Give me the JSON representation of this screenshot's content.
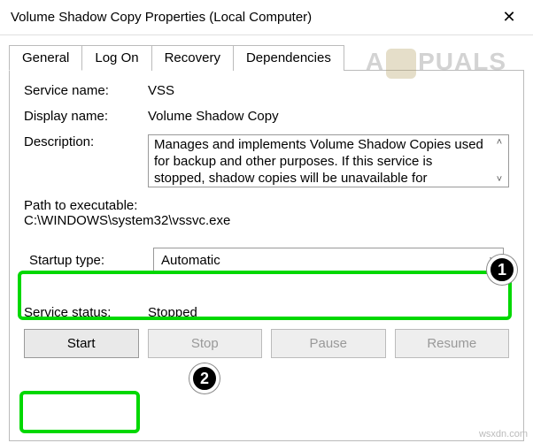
{
  "window": {
    "title": "Volume Shadow Copy Properties (Local Computer)"
  },
  "tabs": [
    {
      "label": "General",
      "active": true
    },
    {
      "label": "Log On",
      "active": false
    },
    {
      "label": "Recovery",
      "active": false
    },
    {
      "label": "Dependencies",
      "active": false
    }
  ],
  "fields": {
    "service_name_label": "Service name:",
    "service_name_value": "VSS",
    "display_name_label": "Display name:",
    "display_name_value": "Volume Shadow Copy",
    "description_label": "Description:",
    "description_value": "Manages and implements Volume Shadow Copies used for backup and other purposes. If this service is stopped, shadow copies will be unavailable for",
    "path_label": "Path to executable:",
    "path_value": "C:\\WINDOWS\\system32\\vssvc.exe",
    "startup_label": "Startup type:",
    "startup_value": "Automatic",
    "status_label": "Service status:",
    "status_value": "Stopped"
  },
  "buttons": {
    "start": "Start",
    "stop": "Stop",
    "pause": "Pause",
    "resume": "Resume"
  },
  "annotations": {
    "badge1": "1",
    "badge2": "2"
  },
  "watermark": {
    "part1": "A",
    "part2": "PUALS"
  },
  "source_note": "wsxdn.com"
}
